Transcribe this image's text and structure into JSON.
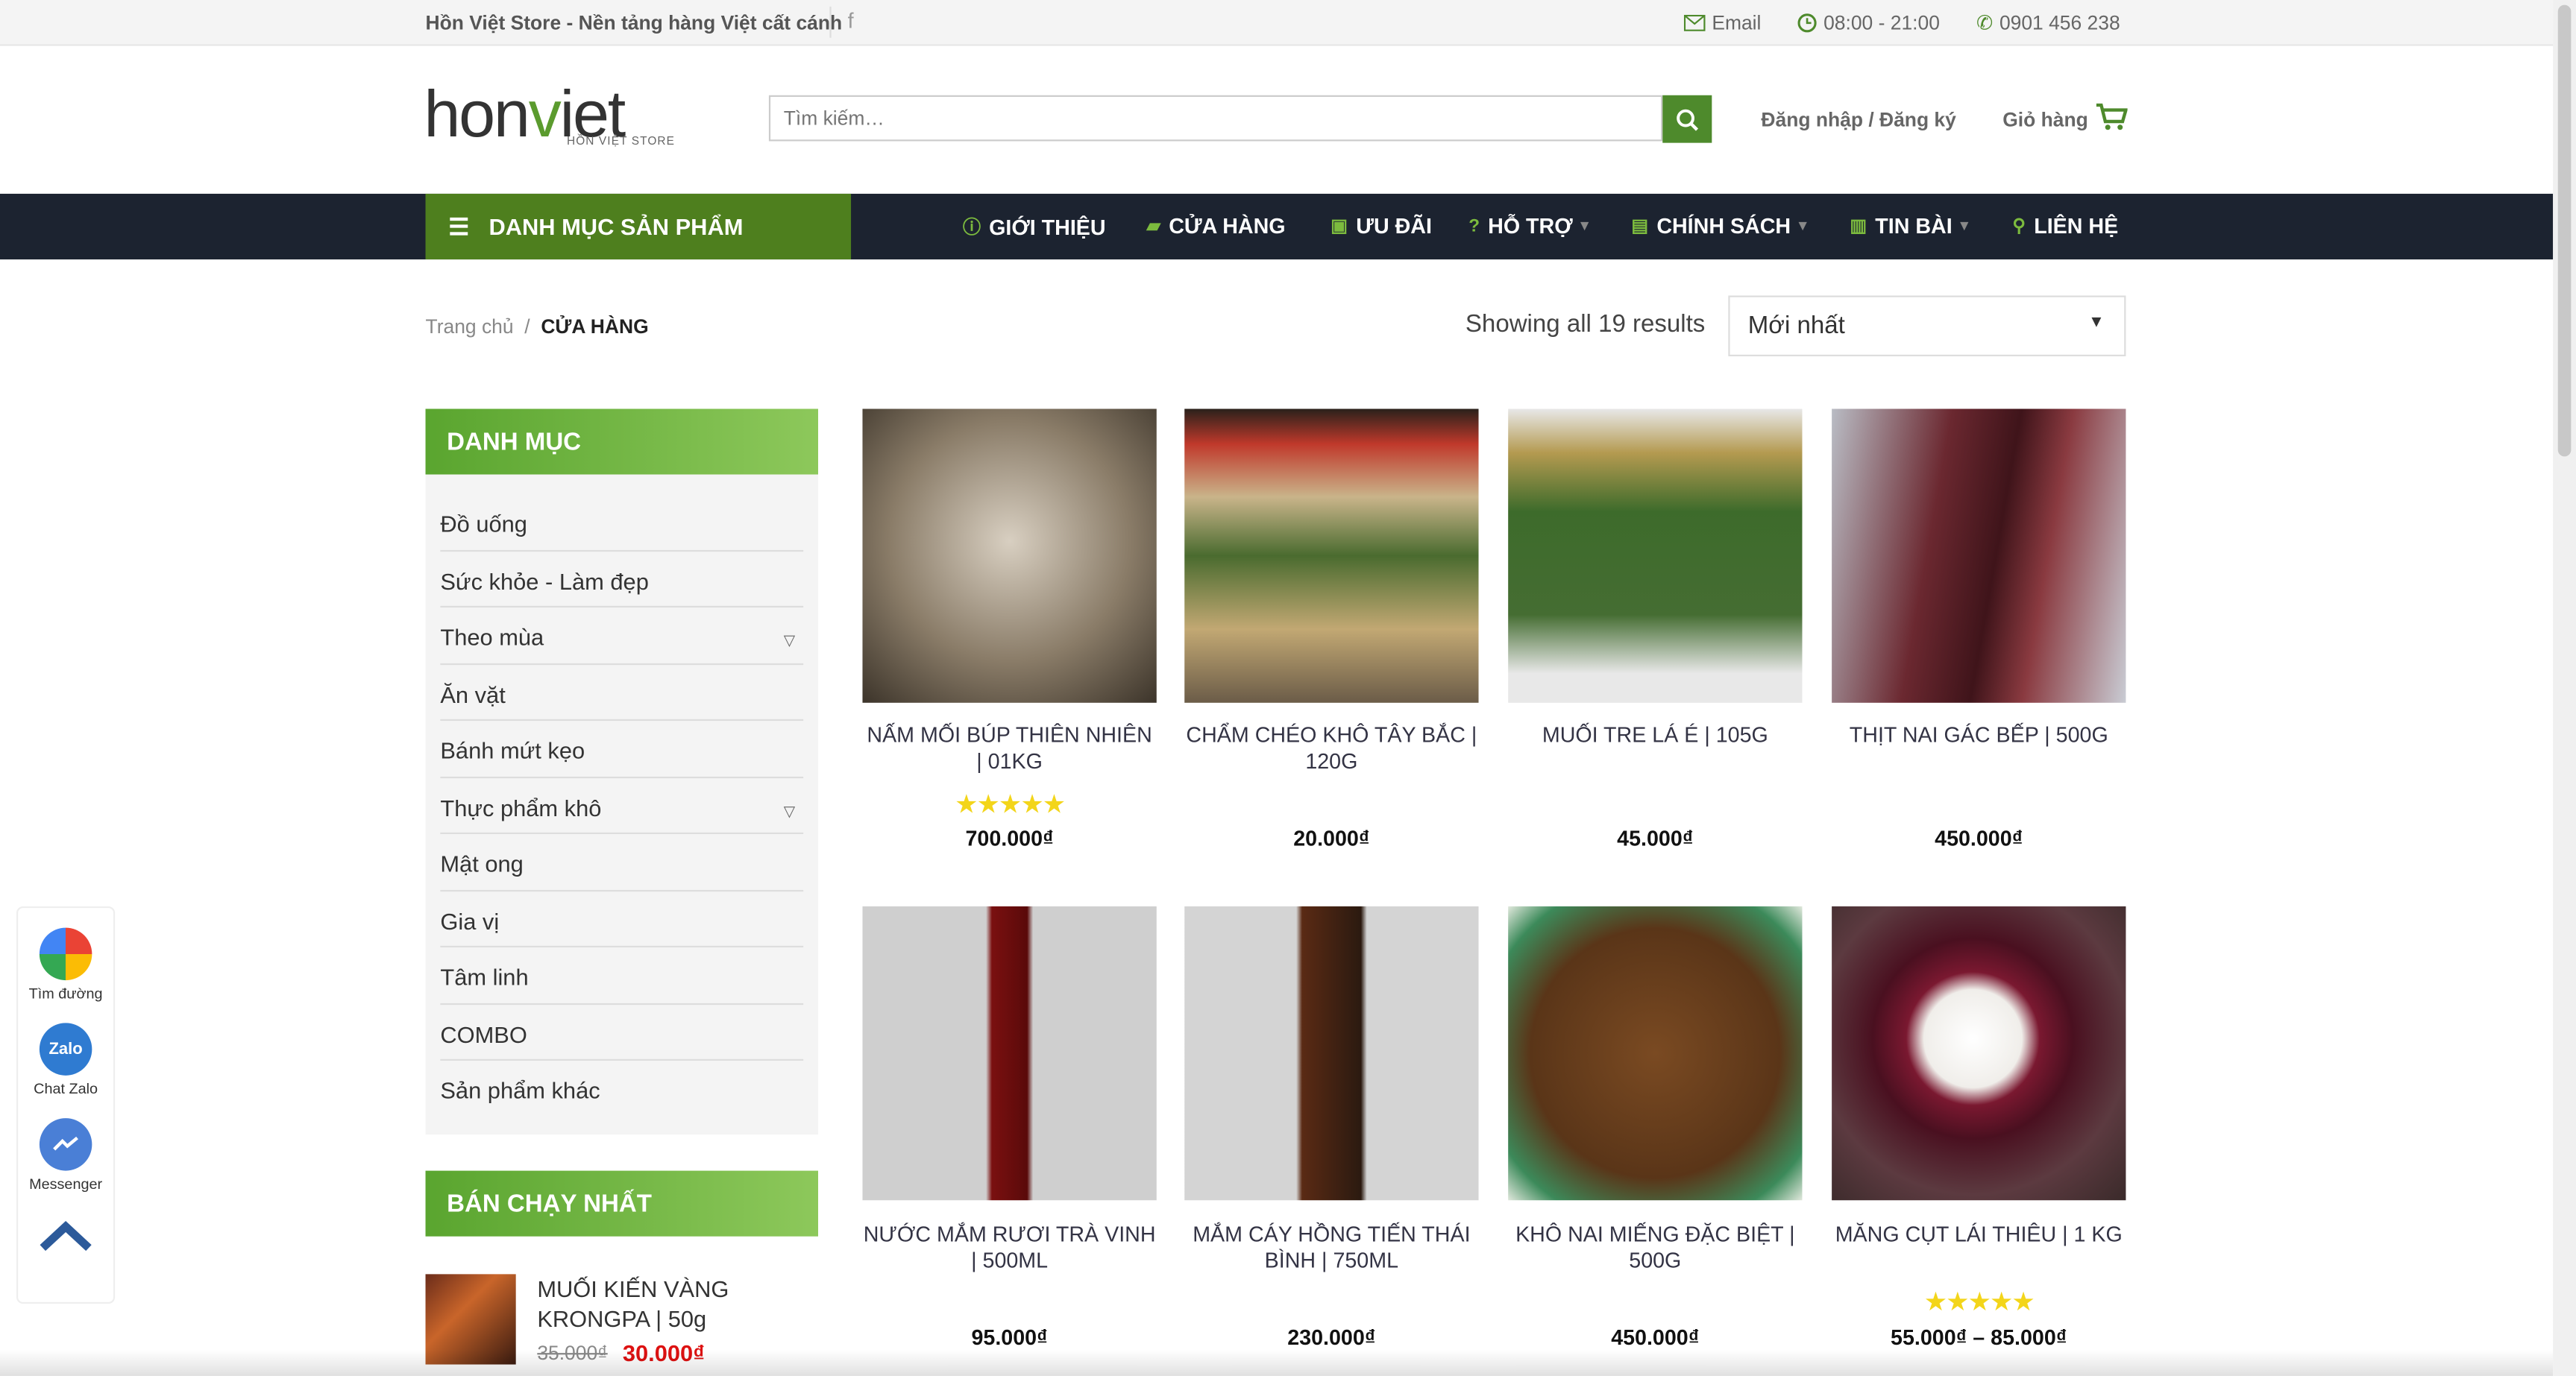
{
  "topbar": {
    "tagline": "Hồn Việt Store - Nền tảng hàng Việt cất cánh",
    "facebook": "f",
    "email": "Email",
    "hours": "08:00 - 21:00",
    "phone": "0901 456 238"
  },
  "header": {
    "logo_text_1": "hon",
    "logo_text_v": "v",
    "logo_text_2": "iet",
    "logo_sub": "HỒN VIỆT STORE",
    "search_placeholder": "Tìm kiếm…",
    "login": "Đăng nhập / Đăng ký",
    "cart": "Giỏ hàng"
  },
  "nav": {
    "category_button": "DANH MỤC SẢN PHẨM",
    "items": [
      {
        "label": "GIỚI THIỆU",
        "icon": "info-icon"
      },
      {
        "label": "CỬA HÀNG",
        "icon": "bag-icon"
      },
      {
        "label": "ƯU ĐÃI",
        "icon": "tag-icon"
      },
      {
        "label": "HỖ TRỢ",
        "icon": "question-icon"
      },
      {
        "label": "CHÍNH SÁCH",
        "icon": "document-icon"
      },
      {
        "label": "TIN BÀI",
        "icon": "newspaper-icon"
      },
      {
        "label": "LIÊN HỆ",
        "icon": "location-icon"
      }
    ]
  },
  "breadcrumb": {
    "home": "Trang chủ",
    "separator": "/",
    "current": "CỬA HÀNG"
  },
  "results": "Showing all 19 results",
  "sort": {
    "selected": "Mới nhất"
  },
  "sidebar": {
    "category_title": "DANH MỤC",
    "categories": [
      "Đồ uống",
      "Sức khỏe - Làm đẹp",
      "Theo mùa",
      "Ăn vặt",
      "Bánh mứt kẹo",
      "Thực phẩm khô",
      "Mật ong",
      "Gia vị",
      "Tâm linh",
      "COMBO",
      "Sản phẩm khác"
    ],
    "bestseller_title": "BÁN CHẠY NHẤT",
    "bestseller": {
      "name": "MUỐI KIẾN VÀNG KRONGPA | 50g",
      "old_price": "35.000₫",
      "new_price": "30.000₫"
    }
  },
  "products": [
    {
      "name": "NẤM MỐI BÚP THIÊN NHIÊN | 01Kg",
      "price": "700.000₫",
      "stars": "★★★★★"
    },
    {
      "name": "CHẨM CHÉO KHÔ TÂY BẮC | 120g",
      "price": "20.000₫"
    },
    {
      "name": "MUỐI TRE LÁ É | 105g",
      "price": "45.000₫"
    },
    {
      "name": "THỊT NAI GÁC BẾP | 500g",
      "price": "450.000₫"
    },
    {
      "name": "NƯỚC MẮM RƯƠI TRÀ VINH | 500ml",
      "price": "95.000₫"
    },
    {
      "name": "MẮM CÁY HỒNG TIẾN THÁI BÌNH | 750ml",
      "price": "230.000₫"
    },
    {
      "name": "KHÔ NAI MIẾNG ĐẶC BIỆT | 500g",
      "price": "450.000₫"
    },
    {
      "name": "MĂNG CỤT LÁI THIÊU | 1 Kg",
      "price": "55.000₫ – 85.000₫",
      "stars": "★★★★★"
    }
  ],
  "floating": {
    "directions": "Tìm đường",
    "zalo_icon": "Zalo",
    "zalo": "Chat Zalo",
    "messenger": "Messenger"
  },
  "colors": {
    "brand_green": "#4e7f1e",
    "nav_dark": "#1c2330",
    "price_red": "#dd1111",
    "star": "#f3d51a"
  }
}
